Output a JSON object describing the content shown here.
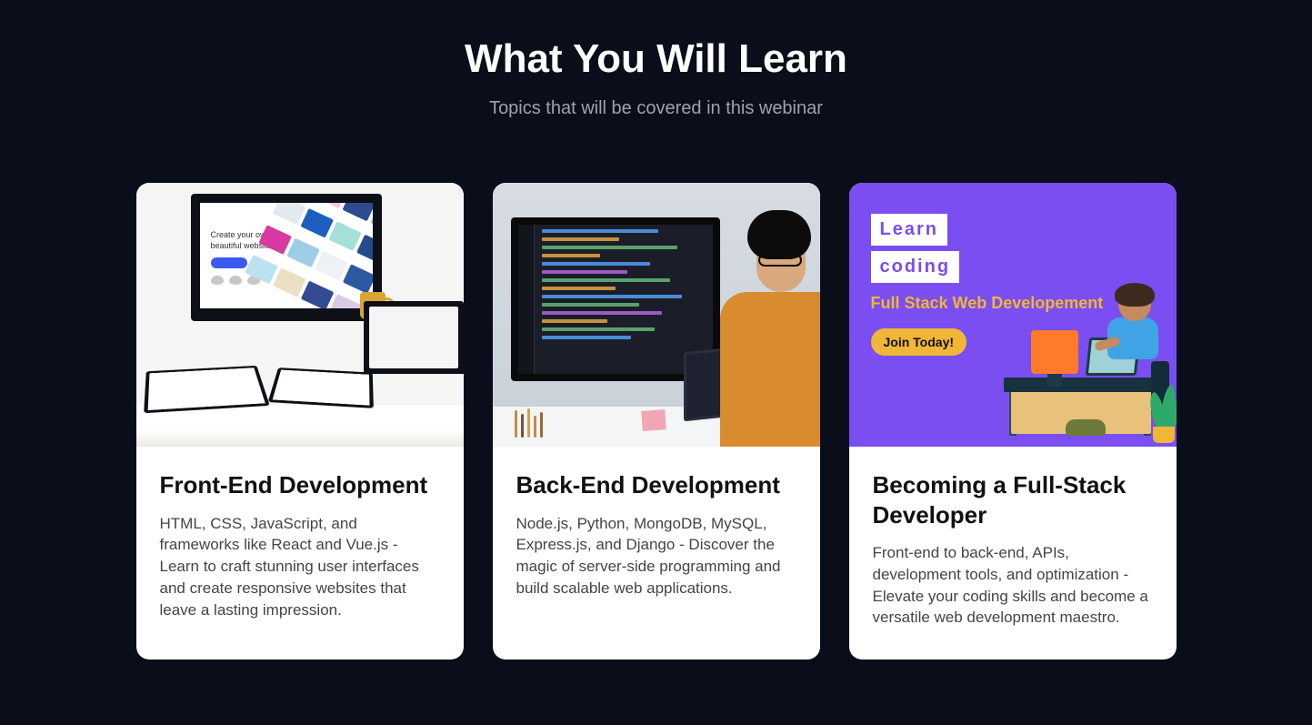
{
  "heading": "What You Will Learn",
  "subheading": "Topics that will be covered in this webinar",
  "cards": [
    {
      "title": "Front-End Development",
      "description": "HTML, CSS, JavaScript, and frameworks like React and Vue.js - Learn to craft stunning user interfaces and create responsive websites that leave a lasting impression.",
      "img": {
        "site_line1": "Create your own",
        "site_line2": "beautiful website"
      }
    },
    {
      "title": "Back-End Development",
      "description": "Node.js, Python, MongoDB, MySQL, Express.js, and Django - Discover the magic of server-side programming and build scalable web applications."
    },
    {
      "title": "Becoming a Full-Stack Developer",
      "description": "Front-end to back-end, APIs, development tools, and optimization - Elevate your coding skills and become a versatile web development maestro.",
      "img": {
        "badge1": "Learn",
        "badge2": "coding",
        "subtitle": "Full Stack Web Developement",
        "cta": "Join Today!"
      }
    }
  ]
}
